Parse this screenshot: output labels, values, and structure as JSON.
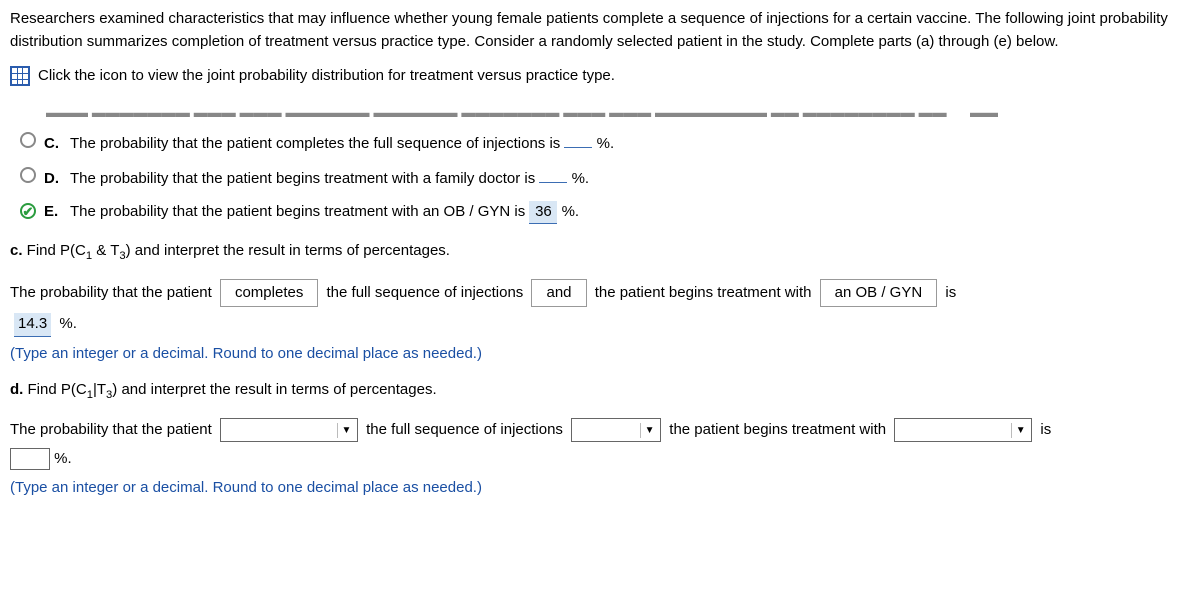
{
  "intro": "Researchers examined characteristics that may influence whether young female patients complete a sequence of injections for a certain vaccine. The following joint probability distribution summarizes completion of treatment versus practice type. Consider a randomly selected patient in the study. Complete parts (a) through (e) below.",
  "icon_link_text": "Click the icon to view the joint probability distribution for treatment versus practice type.",
  "options": {
    "C": {
      "text_before": "The probability that the patient completes the full sequence of injections is",
      "value": "",
      "text_after": "%."
    },
    "D": {
      "text_before": "The probability that the patient begins treatment with a family doctor is",
      "value": "",
      "text_after": "%."
    },
    "E": {
      "text_before": "The probability that the patient begins treatment with an OB / GYN is",
      "value": "36",
      "text_after": "%."
    }
  },
  "part_c": {
    "heading_prefix": "c.",
    "heading_text": "Find P(C₁ & T₃) and interpret the result in terms of percentages.",
    "ans_p1": "The probability that the patient",
    "box1": "completes",
    "ans_p2": "the full sequence of injections",
    "box2": "and",
    "ans_p3": "the patient begins treatment with",
    "box3": "an OB / GYN",
    "ans_p4": "is",
    "value": "14.3",
    "value_suffix": "%.",
    "hint": "(Type an integer or a decimal. Round to one decimal place as needed.)"
  },
  "part_d": {
    "heading_prefix": "d.",
    "heading_text": "Find P(C₁|T₃) and interpret the result in terms of percentages.",
    "ans_p1": "The probability that the patient",
    "ans_p2": "the full sequence of injections",
    "ans_p3": "the patient begins treatment with",
    "ans_p4": "is",
    "value_suffix": "%.",
    "hint": "(Type an integer or a decimal. Round to one decimal place as needed.)"
  }
}
